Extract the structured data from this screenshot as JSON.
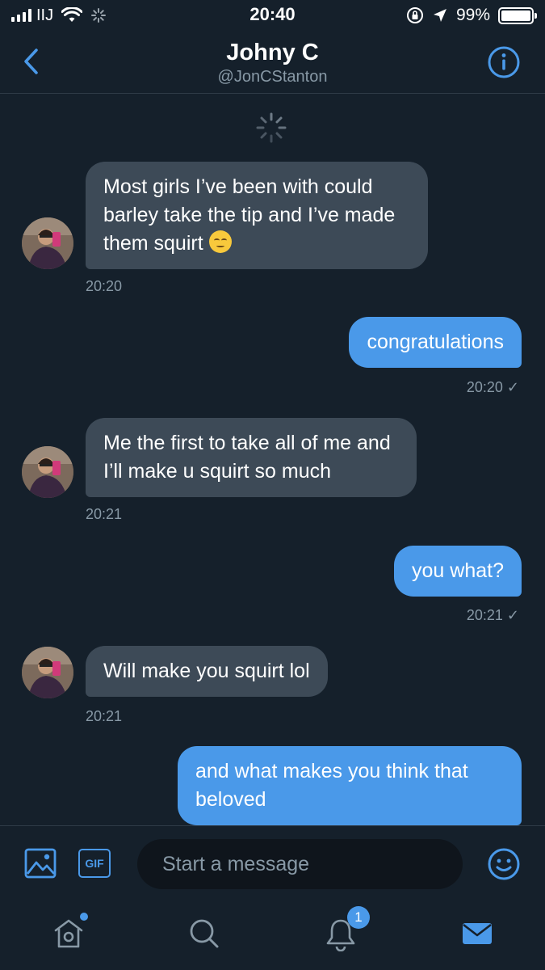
{
  "status_bar": {
    "carrier": "IIJ",
    "time": "20:40",
    "battery": "99%"
  },
  "header": {
    "name": "Johny C",
    "handle": "@JonCStanton"
  },
  "messages": [
    {
      "direction": "in",
      "text": "Most girls I’ve been with could barley take the tip and I’ve made them squirt",
      "emoji": "relieved-face",
      "time": "20:20"
    },
    {
      "direction": "out",
      "text": "congratulations",
      "time": "20:20",
      "status": "✓"
    },
    {
      "direction": "in",
      "text": "Me the first to take all of me and I’ll make u squirt so much",
      "time": "20:21"
    },
    {
      "direction": "out",
      "text": "you what?",
      "time": "20:21",
      "status": "✓"
    },
    {
      "direction": "in",
      "text": "Will make you squirt lol",
      "time": "20:21"
    },
    {
      "direction": "out",
      "text": "and what makes you think that beloved"
    }
  ],
  "composer": {
    "placeholder": "Start a message",
    "gif_label": "GIF"
  },
  "tabbar": {
    "notifications_count": "1"
  },
  "colors": {
    "background": "#15202b",
    "accent": "#4a99e9",
    "incoming_bubble": "#3d4a57",
    "muted_text": "#8899a6"
  }
}
